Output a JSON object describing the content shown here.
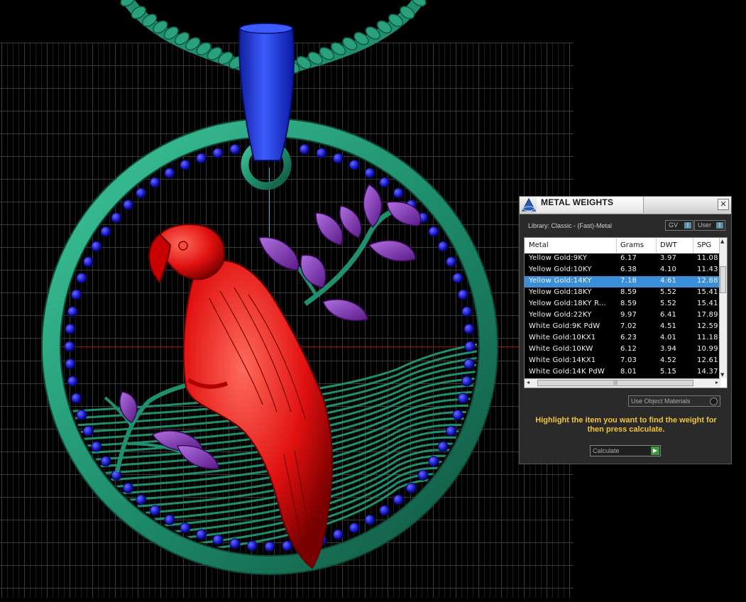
{
  "panel": {
    "title": "METAL WEIGHTS",
    "close_glyph": "✕",
    "library_label": "Library: Classic - (Fast)-Metal",
    "gv_label": "GV",
    "user_label": "User",
    "toggle_glyph": "I",
    "columns": {
      "metal": "Metal",
      "grams": "Grams",
      "dwt": "DWT",
      "spg": "SPG"
    },
    "rows": [
      {
        "metal": "Yellow Gold:9KY",
        "grams": "6.17",
        "dwt": "3.97",
        "spg": "11.08"
      },
      {
        "metal": "Yellow Gold:10KY",
        "grams": "6.38",
        "dwt": "4.10",
        "spg": "11.43"
      },
      {
        "metal": "Yellow Gold:14KY",
        "grams": "7.18",
        "dwt": "4.61",
        "spg": "12.88",
        "selected": true
      },
      {
        "metal": "Yellow Gold:18KY",
        "grams": "8.59",
        "dwt": "5.52",
        "spg": "15.41"
      },
      {
        "metal": "Yellow Gold:18KY R...",
        "grams": "8.59",
        "dwt": "5.52",
        "spg": "15.41"
      },
      {
        "metal": "Yellow Gold:22KY",
        "grams": "9.97",
        "dwt": "6.41",
        "spg": "17.89"
      },
      {
        "metal": "White Gold:9K PdW",
        "grams": "7.02",
        "dwt": "4.51",
        "spg": "12.59"
      },
      {
        "metal": "White Gold:10KX1",
        "grams": "6.23",
        "dwt": "4.01",
        "spg": "11.18"
      },
      {
        "metal": "White Gold:10KW",
        "grams": "6.12",
        "dwt": "3.94",
        "spg": "10.99"
      },
      {
        "metal": "White Gold:14KX1",
        "grams": "7.03",
        "dwt": "4.52",
        "spg": "12.61"
      },
      {
        "metal": "White Gold:14K PdW",
        "grams": "8.01",
        "dwt": "5.15",
        "spg": "14.37"
      }
    ],
    "use_object_materials_label": "Use Object Materials",
    "hint": "Highlight the item you want to find the weight for then press calculate.",
    "calculate_label": "Calculate",
    "calculate_glyph": "▶"
  },
  "colors": {
    "background": "#000000",
    "grid": "#3a3a3a",
    "model_frame": "#1f8f6e",
    "bead": "#1818c8",
    "bail": "#1030e8",
    "parrot": "#e01010",
    "leaves": "#7a2aa8",
    "selected_row": "#3a8fd8",
    "hint_text": "#f2c43a"
  }
}
